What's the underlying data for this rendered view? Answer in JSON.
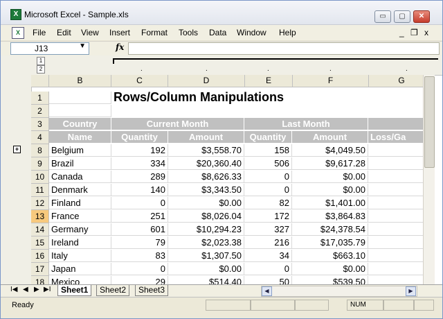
{
  "window": {
    "title": "Microsoft Excel - Sample.xls",
    "app_icon": "X",
    "buttons": {
      "minimize": "▭",
      "restore": "▢",
      "close": "✕"
    }
  },
  "menu": {
    "items": [
      "File",
      "Edit",
      "View",
      "Insert",
      "Format",
      "Tools",
      "Data",
      "Window",
      "Help"
    ],
    "doc_minimize": "_",
    "doc_restore": "❐",
    "doc_close": "x"
  },
  "formula_bar": {
    "name_box": "J13",
    "fx_label": "fx",
    "formula": ""
  },
  "outline": {
    "col_levels": [
      "1",
      "2"
    ],
    "row_levels": [
      "1",
      "2"
    ],
    "expand_symbol": "+"
  },
  "columns": [
    "B",
    "C",
    "D",
    "E",
    "F",
    "G"
  ],
  "sheet": {
    "title": "Rows/Column Manipulations",
    "group_headers": {
      "country": "Country",
      "current_month": "Current Month",
      "last_month": "Last Month"
    },
    "sub_headers": {
      "name": "Name",
      "quantity_current": "Quantity",
      "amount_current": "Amount",
      "quantity_last": "Quantity",
      "amount_last": "Amount",
      "loss_gain": "Loss/Ga"
    },
    "row_numbers": [
      "1",
      "2",
      "3",
      "4",
      "8",
      "9",
      "10",
      "11",
      "12",
      "13",
      "14",
      "15",
      "16",
      "17",
      "18"
    ],
    "selected_row": "13",
    "rows": [
      {
        "num": "8",
        "country": "Belgium",
        "qty_cur": "192",
        "amt_cur": "$3,558.70",
        "qty_last": "158",
        "amt_last": "$4,049.50"
      },
      {
        "num": "9",
        "country": "Brazil",
        "qty_cur": "334",
        "amt_cur": "$20,360.40",
        "qty_last": "506",
        "amt_last": "$9,617.28"
      },
      {
        "num": "10",
        "country": "Canada",
        "qty_cur": "289",
        "amt_cur": "$8,626.33",
        "qty_last": "0",
        "amt_last": "$0.00"
      },
      {
        "num": "11",
        "country": "Denmark",
        "qty_cur": "140",
        "amt_cur": "$3,343.50",
        "qty_last": "0",
        "amt_last": "$0.00"
      },
      {
        "num": "12",
        "country": "Finland",
        "qty_cur": "0",
        "amt_cur": "$0.00",
        "qty_last": "82",
        "amt_last": "$1,401.00"
      },
      {
        "num": "13",
        "country": "France",
        "qty_cur": "251",
        "amt_cur": "$8,026.04",
        "qty_last": "172",
        "amt_last": "$3,864.83"
      },
      {
        "num": "14",
        "country": "Germany",
        "qty_cur": "601",
        "amt_cur": "$10,294.23",
        "qty_last": "327",
        "amt_last": "$24,378.54"
      },
      {
        "num": "15",
        "country": "Ireland",
        "qty_cur": "79",
        "amt_cur": "$2,023.38",
        "qty_last": "216",
        "amt_last": "$17,035.79"
      },
      {
        "num": "16",
        "country": "Italy",
        "qty_cur": "83",
        "amt_cur": "$1,307.50",
        "qty_last": "34",
        "amt_last": "$663.10"
      },
      {
        "num": "17",
        "country": "Japan",
        "qty_cur": "0",
        "amt_cur": "$0.00",
        "qty_last": "0",
        "amt_last": "$0.00"
      },
      {
        "num": "18",
        "country": "Mexico",
        "qty_cur": "29",
        "amt_cur": "$514.40",
        "qty_last": "50",
        "amt_last": "$539.50"
      }
    ]
  },
  "tabs": {
    "nav": [
      "I◀",
      "◀",
      "▶",
      "▶I"
    ],
    "sheets": [
      "Sheet1",
      "Sheet2",
      "Sheet3"
    ],
    "active": "Sheet1"
  },
  "status": {
    "ready": "Ready",
    "num": "NUM"
  }
}
